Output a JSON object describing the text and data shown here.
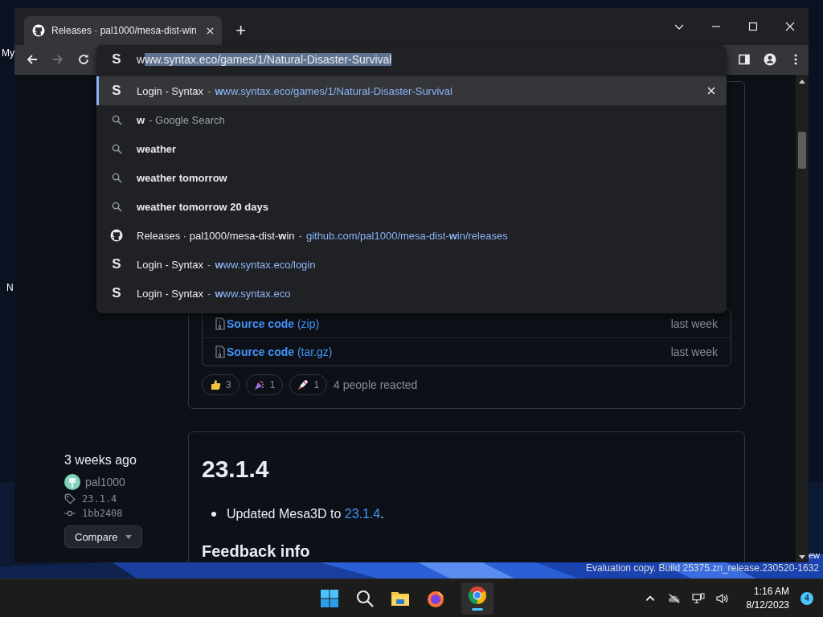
{
  "desktop": {
    "icon_labels": [
      "My",
      "N",
      "ew"
    ],
    "watermark": "Evaluation copy. Build 25375.zn_release.230520-1632"
  },
  "browser": {
    "tabs": [
      {
        "title": "Releases · pal1000/mesa-dist-win",
        "selected": true
      }
    ],
    "new_tab": "+",
    "omnibox": {
      "favicon": "S",
      "typed": "w",
      "completion": "ww.syntax.eco/games/1/Natural-Disaster-Survival"
    },
    "suggestions": [
      {
        "kind": "site",
        "favicon": "S",
        "title": "Login - Syntax",
        "separator": "-",
        "url": "**w**ww.syntax.eco/games/1/Natural-Disaster-Survival",
        "selected": true
      },
      {
        "kind": "search",
        "query": "w",
        "separator": "-",
        "suffix": "Google Search",
        "selected": false
      },
      {
        "kind": "search",
        "query": "weather",
        "selected": false
      },
      {
        "kind": "search",
        "query": "weather tomorrow",
        "selected": false
      },
      {
        "kind": "search",
        "query": "weather tomorrow 20 days",
        "selected": false
      },
      {
        "kind": "github",
        "title": "Releases · pal1000/mesa-dist-**w**in",
        "separator": "-",
        "url": "github.com/pal1000/mesa-dist-**w**in/releases",
        "selected": false
      },
      {
        "kind": "site",
        "favicon": "S",
        "title": "Login - Syntax",
        "separator": "-",
        "url": "**w**ww.syntax.eco/login",
        "selected": false
      },
      {
        "kind": "site",
        "favicon": "S",
        "title": "Login - Syntax",
        "separator": "-",
        "url": "**w**ww.syntax.eco",
        "selected": false
      }
    ]
  },
  "page": {
    "assets": [
      {
        "name": "Source code",
        "ext": "(zip)",
        "time": "last week"
      },
      {
        "name": "Source code",
        "ext": "(tar.gz)",
        "time": "last week"
      }
    ],
    "reactions": [
      {
        "kind": "thumbs_up",
        "count": "3"
      },
      {
        "kind": "hooray",
        "count": "1"
      },
      {
        "kind": "rocket",
        "count": "1"
      }
    ],
    "reacted": "4 people reacted",
    "release": {
      "date": "3 weeks ago",
      "author": "pal1000",
      "tag": "23.1.4",
      "commit": "1bb2408",
      "compare": "Compare",
      "title": "23.1.4",
      "notes": [
        {
          "text": "Updated Mesa3D to ",
          "link": "23.1.4",
          "end": "."
        }
      ],
      "section": "Feedback info"
    }
  },
  "taskbar": {
    "time": "1:16 AM",
    "date": "8/12/2023",
    "notifications": "4"
  }
}
